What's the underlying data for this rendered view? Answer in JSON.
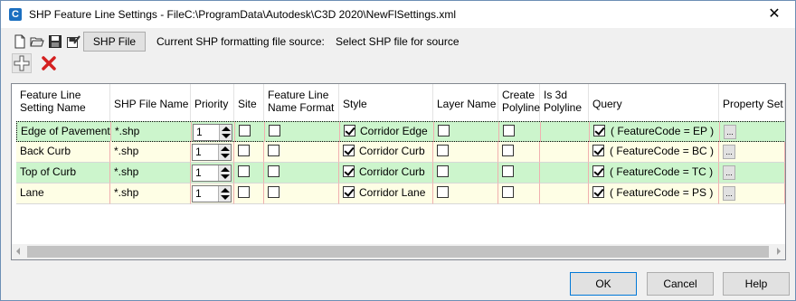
{
  "window": {
    "title": "SHP Feature Line Settings  -  FileC:\\ProgramData\\Autodesk\\C3D 2020\\NewFlSettings.xml",
    "app_icon_letter": "C",
    "close_glyph": "✕"
  },
  "toolbar": {
    "icons": [
      "new-file-icon",
      "open-folder-icon",
      "save-icon",
      "save-as-icon"
    ],
    "shp_button_label": "SHP File",
    "source_label": "Current SHP formatting file source:",
    "source_value": "Select SHP file for source",
    "add_icon": "add-plus-icon",
    "delete_icon": "delete-x-icon"
  },
  "grid": {
    "columns": [
      [
        "Feature Line",
        "Setting Name"
      ],
      [
        "SHP File Name"
      ],
      [
        "Priority"
      ],
      [
        "Site"
      ],
      [
        "Feature Line",
        "Name Format"
      ],
      [
        "Style"
      ],
      [
        "Layer Name"
      ],
      [
        "Create",
        "Polyline"
      ],
      [
        "Is 3d",
        "Polyline"
      ],
      [
        "Query"
      ],
      [
        "Property Set"
      ]
    ],
    "rows": [
      {
        "name": "Edge of Pavement",
        "file": "*.shp",
        "priority": "1",
        "site": false,
        "name_format": false,
        "style_checked": true,
        "style": "Corridor Edge",
        "layer": false,
        "create_polyline": false,
        "query_checked": true,
        "query": "( FeatureCode = EP )",
        "property_set_btn": "...",
        "tone": "green"
      },
      {
        "name": "Back Curb",
        "file": "*.shp",
        "priority": "1",
        "site": false,
        "name_format": false,
        "style_checked": true,
        "style": "Corridor Curb",
        "layer": false,
        "create_polyline": false,
        "query_checked": true,
        "query": "( FeatureCode = BC )",
        "property_set_btn": "...",
        "tone": "cream"
      },
      {
        "name": "Top of Curb",
        "file": "*.shp",
        "priority": "1",
        "site": false,
        "name_format": false,
        "style_checked": true,
        "style": "Corridor Curb",
        "layer": false,
        "create_polyline": false,
        "query_checked": true,
        "query": "( FeatureCode = TC )",
        "property_set_btn": "...",
        "tone": "green"
      },
      {
        "name": "Lane",
        "file": "*.shp",
        "priority": "1",
        "site": false,
        "name_format": false,
        "style_checked": true,
        "style": "Corridor Lane",
        "layer": false,
        "create_polyline": false,
        "query_checked": true,
        "query": "( FeatureCode = PS )",
        "property_set_btn": "...",
        "tone": "cream"
      }
    ]
  },
  "buttons": {
    "ok": "OK",
    "cancel": "Cancel",
    "help": "Help"
  }
}
